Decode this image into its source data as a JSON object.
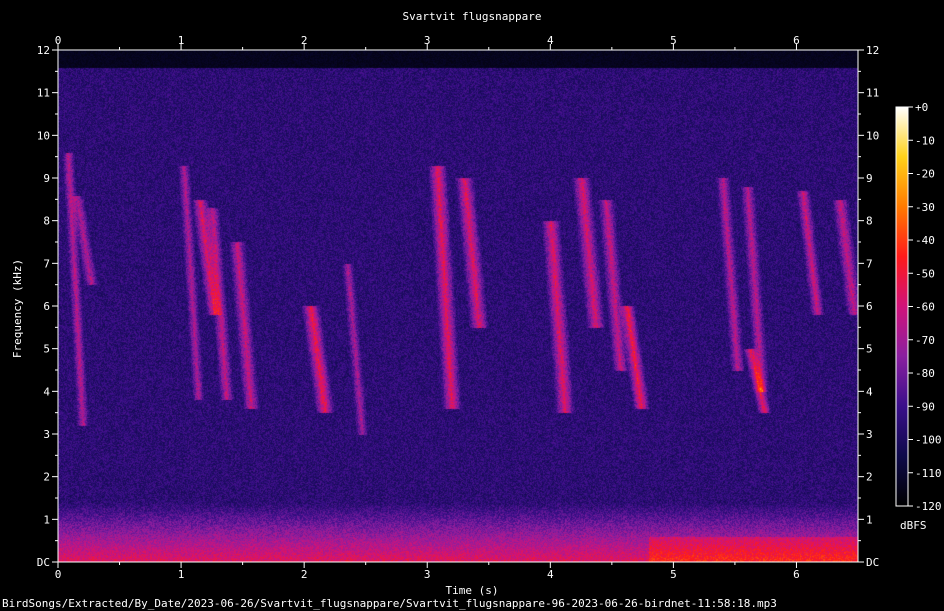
{
  "chart_data": {
    "type": "heatmap",
    "title": "Svartvit flugsnappare",
    "xlabel": "Time (s)",
    "ylabel": "Frequency (kHz)",
    "xlim": [
      0,
      6.5
    ],
    "ylim": [
      0,
      12
    ],
    "x_ticks": [
      "0",
      "1",
      "2",
      "3",
      "4",
      "5",
      "6"
    ],
    "y_ticks": [
      "DC",
      "1",
      "2",
      "3",
      "4",
      "5",
      "6",
      "7",
      "8",
      "9",
      "10",
      "11",
      "12"
    ],
    "colorbar": {
      "label": "dBFS",
      "range": [
        -120,
        0
      ],
      "ticks": [
        "+0",
        "-10",
        "-20",
        "-30",
        "-40",
        "-50",
        "-60",
        "-70",
        "-80",
        "-90",
        "-100",
        "-110",
        "-120"
      ]
    },
    "colormap": [
      "#000000",
      "#0e0a4a",
      "#3a0f8a",
      "#8a1fa0",
      "#d0137a",
      "#ff1a1a",
      "#ff7a00",
      "#ffd21a",
      "#ffffff"
    ],
    "grid": false
  },
  "footer": "BirdSongs/Extracted/By_Date/2023-06-26/Svartvit_flugsnappare/Svartvit_flugsnappare-96-2023-06-26-birdnet-11:58:18.mp3"
}
